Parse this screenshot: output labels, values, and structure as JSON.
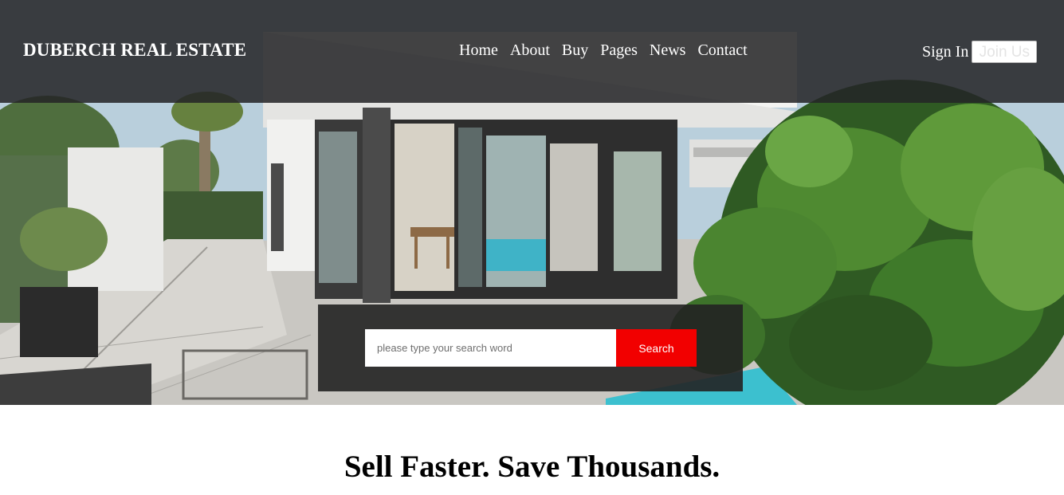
{
  "brand": {
    "name": "DUBERCH REAL ESTATE"
  },
  "nav": {
    "items": [
      {
        "label": "Home"
      },
      {
        "label": "About"
      },
      {
        "label": "Buy"
      },
      {
        "label": "Pages"
      },
      {
        "label": "News"
      },
      {
        "label": "Contact"
      }
    ]
  },
  "auth": {
    "sign_in": "Sign In",
    "join_us": "Join Us"
  },
  "search": {
    "placeholder": "please type your search word",
    "value": "",
    "button": "Search"
  },
  "hero": {
    "image": "modern-villa-exterior"
  },
  "headline": "Sell Faster. Save Thousands.",
  "colors": {
    "accent": "#f20000",
    "navbar_bg": "#242426",
    "panel_bg": "#222222"
  }
}
